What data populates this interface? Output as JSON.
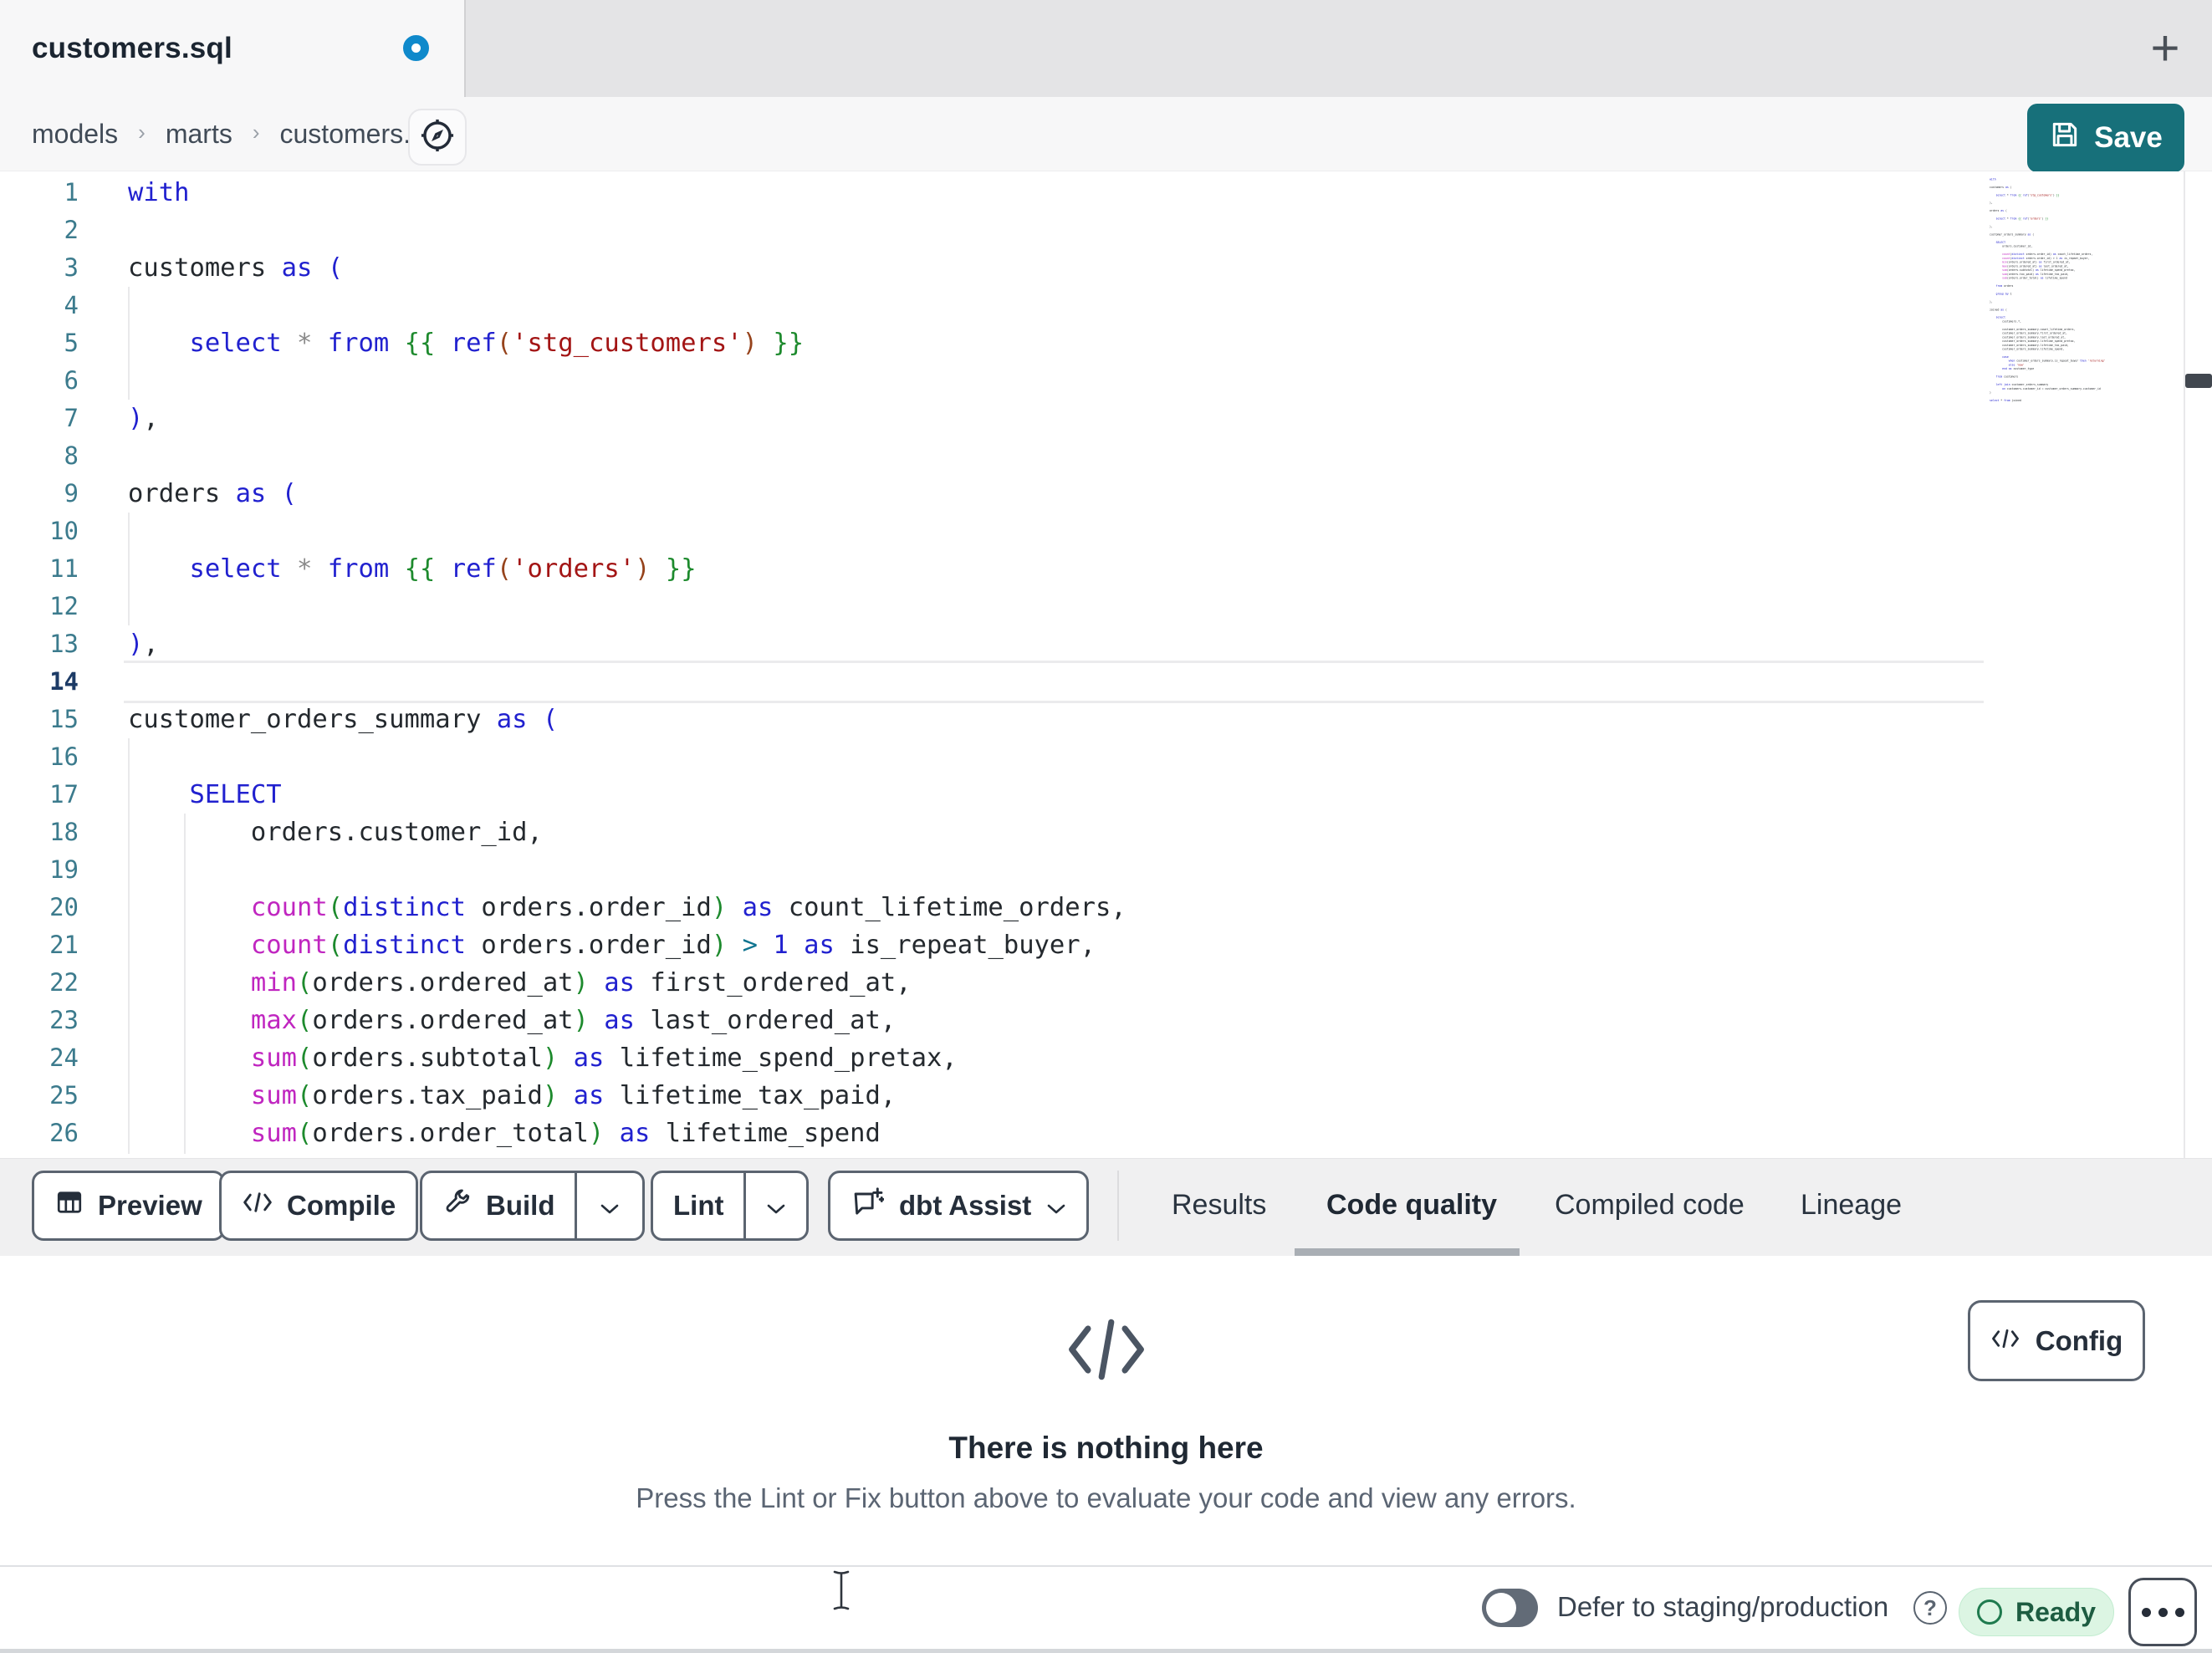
{
  "window": {
    "tab_title": "customers.sql",
    "new_tab_label": "+"
  },
  "breadcrumb": {
    "items": [
      "models",
      "marts",
      "customers.sql"
    ],
    "separator": "›"
  },
  "save_button": {
    "label": "Save"
  },
  "editor": {
    "active_line": 14,
    "lines": [
      {
        "n": 1,
        "t": [
          [
            "kw",
            "with"
          ]
        ]
      },
      {
        "n": 2,
        "t": []
      },
      {
        "n": 3,
        "t": [
          [
            "id",
            "customers"
          ],
          [
            "pl",
            " "
          ],
          [
            "kw",
            "as"
          ],
          [
            "pl",
            " "
          ],
          [
            "kw",
            "("
          ]
        ]
      },
      {
        "n": 4,
        "t": []
      },
      {
        "n": 5,
        "t": [
          [
            "pl",
            "    "
          ],
          [
            "kw",
            "select"
          ],
          [
            "pl",
            " "
          ],
          [
            "op",
            "*"
          ],
          [
            "pl",
            " "
          ],
          [
            "kw",
            "from"
          ],
          [
            "pl",
            " "
          ],
          [
            "jj",
            "{{"
          ],
          [
            "pl",
            " "
          ],
          [
            "kw",
            "ref"
          ],
          [
            "bk",
            "("
          ],
          [
            "st",
            "'stg_customers'"
          ],
          [
            "bk",
            ")"
          ],
          [
            "pl",
            " "
          ],
          [
            "jj",
            "}}"
          ]
        ]
      },
      {
        "n": 6,
        "t": []
      },
      {
        "n": 7,
        "t": [
          [
            "kw",
            ")"
          ],
          [
            "id",
            ","
          ]
        ]
      },
      {
        "n": 8,
        "t": []
      },
      {
        "n": 9,
        "t": [
          [
            "id",
            "orders"
          ],
          [
            "pl",
            " "
          ],
          [
            "kw",
            "as"
          ],
          [
            "pl",
            " "
          ],
          [
            "kw",
            "("
          ]
        ]
      },
      {
        "n": 10,
        "t": []
      },
      {
        "n": 11,
        "t": [
          [
            "pl",
            "    "
          ],
          [
            "kw",
            "select"
          ],
          [
            "pl",
            " "
          ],
          [
            "op",
            "*"
          ],
          [
            "pl",
            " "
          ],
          [
            "kw",
            "from"
          ],
          [
            "pl",
            " "
          ],
          [
            "jj",
            "{{"
          ],
          [
            "pl",
            " "
          ],
          [
            "kw",
            "ref"
          ],
          [
            "bk",
            "("
          ],
          [
            "st",
            "'orders'"
          ],
          [
            "bk",
            ")"
          ],
          [
            "pl",
            " "
          ],
          [
            "jj",
            "}}"
          ]
        ]
      },
      {
        "n": 12,
        "t": []
      },
      {
        "n": 13,
        "t": [
          [
            "kw",
            ")"
          ],
          [
            "id",
            ","
          ]
        ]
      },
      {
        "n": 14,
        "t": []
      },
      {
        "n": 15,
        "t": [
          [
            "id",
            "customer_orders_summary"
          ],
          [
            "pl",
            " "
          ],
          [
            "kw",
            "as"
          ],
          [
            "pl",
            " "
          ],
          [
            "kw",
            "("
          ]
        ]
      },
      {
        "n": 16,
        "t": []
      },
      {
        "n": 17,
        "t": [
          [
            "pl",
            "    "
          ],
          [
            "kw",
            "SELECT"
          ]
        ]
      },
      {
        "n": 18,
        "t": [
          [
            "pl",
            "        "
          ],
          [
            "id",
            "orders.customer_id,"
          ]
        ]
      },
      {
        "n": 19,
        "t": []
      },
      {
        "n": 20,
        "t": [
          [
            "pl",
            "        "
          ],
          [
            "fn",
            "count"
          ],
          [
            "pg",
            "("
          ],
          [
            "kw",
            "distinct"
          ],
          [
            "pl",
            " "
          ],
          [
            "id",
            "orders.order_id"
          ],
          [
            "pg",
            ")"
          ],
          [
            "pl",
            " "
          ],
          [
            "kw",
            "as"
          ],
          [
            "pl",
            " "
          ],
          [
            "id",
            "count_lifetime_orders,"
          ]
        ]
      },
      {
        "n": 21,
        "t": [
          [
            "pl",
            "        "
          ],
          [
            "fn",
            "count"
          ],
          [
            "pg",
            "("
          ],
          [
            "kw",
            "distinct"
          ],
          [
            "pl",
            " "
          ],
          [
            "id",
            "orders.order_id"
          ],
          [
            "pg",
            ")"
          ],
          [
            "pl",
            " "
          ],
          [
            "o2",
            ">"
          ],
          [
            "pl",
            " "
          ],
          [
            "nm",
            "1"
          ],
          [
            "pl",
            " "
          ],
          [
            "kw",
            "as"
          ],
          [
            "pl",
            " "
          ],
          [
            "id",
            "is_repeat_buyer,"
          ]
        ]
      },
      {
        "n": 22,
        "t": [
          [
            "pl",
            "        "
          ],
          [
            "fn",
            "min"
          ],
          [
            "pg",
            "("
          ],
          [
            "id",
            "orders.ordered_at"
          ],
          [
            "pg",
            ")"
          ],
          [
            "pl",
            " "
          ],
          [
            "kw",
            "as"
          ],
          [
            "pl",
            " "
          ],
          [
            "id",
            "first_ordered_at,"
          ]
        ]
      },
      {
        "n": 23,
        "t": [
          [
            "pl",
            "        "
          ],
          [
            "fn",
            "max"
          ],
          [
            "pg",
            "("
          ],
          [
            "id",
            "orders.ordered_at"
          ],
          [
            "pg",
            ")"
          ],
          [
            "pl",
            " "
          ],
          [
            "kw",
            "as"
          ],
          [
            "pl",
            " "
          ],
          [
            "id",
            "last_ordered_at,"
          ]
        ]
      },
      {
        "n": 24,
        "t": [
          [
            "pl",
            "        "
          ],
          [
            "fn",
            "sum"
          ],
          [
            "pg",
            "("
          ],
          [
            "id",
            "orders.subtotal"
          ],
          [
            "pg",
            ")"
          ],
          [
            "pl",
            " "
          ],
          [
            "kw",
            "as"
          ],
          [
            "pl",
            " "
          ],
          [
            "id",
            "lifetime_spend_pretax,"
          ]
        ]
      },
      {
        "n": 25,
        "t": [
          [
            "pl",
            "        "
          ],
          [
            "fn",
            "sum"
          ],
          [
            "pg",
            "("
          ],
          [
            "id",
            "orders.tax_paid"
          ],
          [
            "pg",
            ")"
          ],
          [
            "pl",
            " "
          ],
          [
            "kw",
            "as"
          ],
          [
            "pl",
            " "
          ],
          [
            "id",
            "lifetime_tax_paid,"
          ]
        ]
      },
      {
        "n": 26,
        "t": [
          [
            "pl",
            "        "
          ],
          [
            "fn",
            "sum"
          ],
          [
            "pg",
            "("
          ],
          [
            "id",
            "orders.order_total"
          ],
          [
            "pg",
            ")"
          ],
          [
            "pl",
            " "
          ],
          [
            "kw",
            "as"
          ],
          [
            "pl",
            " "
          ],
          [
            "id",
            "lifetime_spend"
          ]
        ]
      }
    ],
    "minimap_lines": [
      "with",
      "",
      "customers as (",
      "",
      "    select * from {{ ref('stg_customers') }}",
      "",
      "),",
      "",
      "orders as (",
      "",
      "    select * from {{ ref('orders') }}",
      "",
      "),",
      "",
      "customer_orders_summary as (",
      "",
      "    SELECT",
      "        orders.customer_id,",
      "",
      "        count(distinct orders.order_id) as count_lifetime_orders,",
      "        count(distinct orders.order_id) > 1 as is_repeat_buyer,",
      "        min(orders.ordered_at) as first_ordered_at,",
      "        max(orders.ordered_at) as last_ordered_at,",
      "        sum(orders.subtotal) as lifetime_spend_pretax,",
      "        sum(orders.tax_paid) as lifetime_tax_paid,",
      "        sum(orders.order_total) as lifetime_spend",
      "",
      "    from orders",
      "",
      "    group by 1",
      "",
      "),",
      "",
      "joined as (",
      "",
      "    select",
      "        customers.*,",
      "",
      "        customer_orders_summary.count_lifetime_orders,",
      "        customer_orders_summary.first_ordered_at,",
      "        customer_orders_summary.last_ordered_at,",
      "        customer_orders_summary.lifetime_spend_pretax,",
      "        customer_orders_summary.lifetime_tax_paid,",
      "        customer_orders_summary.lifetime_spend,",
      "",
      "        case",
      "            when customer_orders_summary.is_repeat_buyer then 'returning'",
      "            else 'new'",
      "        end as customer_type",
      "",
      "    from customers",
      "",
      "    left join customer_orders_summary",
      "        on customers.customer_id = customer_orders_summary.customer_id",
      ")",
      "",
      "select * from joined"
    ]
  },
  "toolbar": {
    "preview_label": "Preview",
    "compile_label": "Compile",
    "build_label": "Build",
    "lint_label": "Lint",
    "dbt_assist_label": "dbt Assist"
  },
  "result_tabs": {
    "items": [
      "Results",
      "Code quality",
      "Compiled code",
      "Lineage"
    ],
    "active": "Code quality"
  },
  "empty_state": {
    "title": "There is nothing here",
    "description": "Press the Lint or Fix button above to evaluate your code and view any errors.",
    "config_label": "Config"
  },
  "statusbar": {
    "defer_label": "Defer to staging/production",
    "help_icon": "?",
    "ready_label": "Ready"
  },
  "colors": {
    "save_button": "#17707a",
    "unsaved_dot": "#0f89cb",
    "ready_bg": "#dcf5e3",
    "ready_text": "#1d5c41",
    "keyword": "#2121cf",
    "function": "#c026c0",
    "string": "#a31515",
    "jinja": "#1d8a2d",
    "line_number": "#3c7b8d"
  }
}
